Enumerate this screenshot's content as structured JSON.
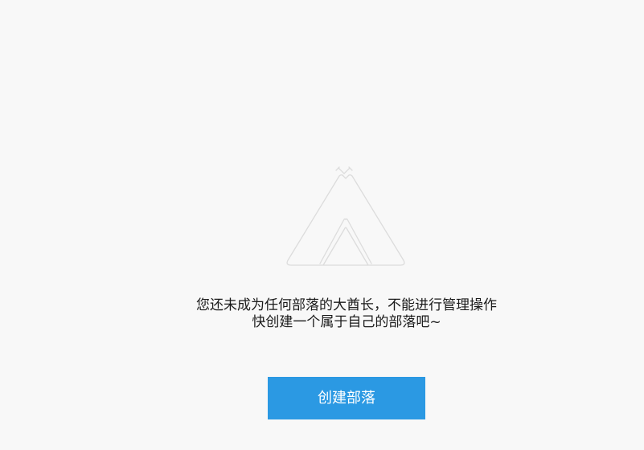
{
  "empty_state": {
    "icon": "tent-icon",
    "message_line1": "您还未成为任何部落的大酋长，不能进行管理操作",
    "message_line2": "快创建一个属于自己的部落吧~",
    "button_label": "创建部落",
    "colors": {
      "background": "#f8f8f8",
      "icon_stroke": "#dcdcdc",
      "text": "#1a1a1a",
      "button": "#2b99e3",
      "button_text": "#ffffff"
    }
  }
}
